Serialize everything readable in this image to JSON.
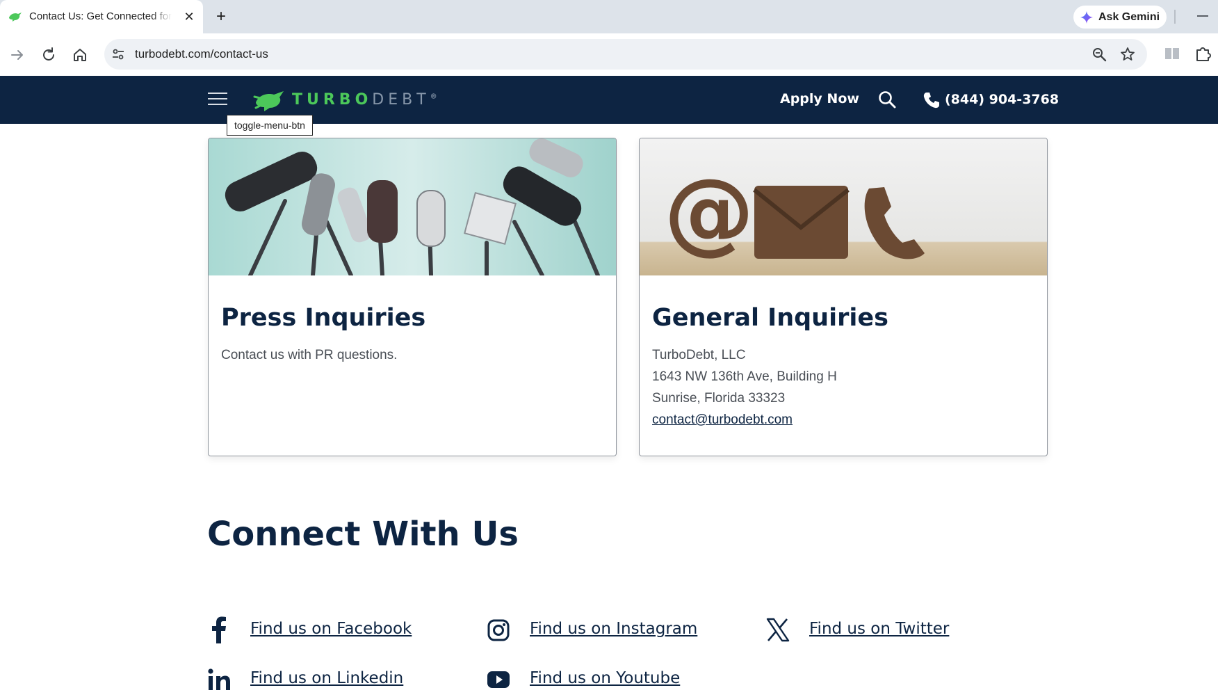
{
  "browser": {
    "tab_title": "Contact Us: Get Connected for Debt Help",
    "tab_close": "✕",
    "new_tab": "+",
    "gemini_label": "Ask Gemini",
    "url": "turbodebt.com/contact-us"
  },
  "header": {
    "logo_turbo": "TURBO",
    "logo_debt": "DEBT",
    "logo_mark": "®",
    "apply_now": "Apply Now",
    "phone": "(844) 904-3768",
    "tooltip": "toggle-menu-btn"
  },
  "cards": [
    {
      "image_icon": "microphones-image",
      "title": "Press Inquiries",
      "lines": [
        "Contact us with PR questions."
      ]
    },
    {
      "image_icon": "contact-symbols-image",
      "title": "General Inquiries",
      "lines": [
        "TurboDebt, LLC",
        "1643 NW 136th Ave, Building H",
        "Sunrise, Florida 33323"
      ],
      "email": "contact@turbodebt.com"
    }
  ],
  "connect": {
    "title": "Connect With Us",
    "links": [
      {
        "icon": "facebook-icon",
        "label": "Find us on Facebook"
      },
      {
        "icon": "instagram-icon",
        "label": "Find us on Instagram"
      },
      {
        "icon": "x-twitter-icon",
        "label": "Find us on Twitter"
      },
      {
        "icon": "linkedin-icon",
        "label": "Find us on Linkedin"
      },
      {
        "icon": "youtube-icon",
        "label": "Find us on Youtube"
      }
    ]
  },
  "colors": {
    "brand_navy": "#0d2442",
    "brand_green": "#4cc85a",
    "tab_strip": "#dde3ea"
  }
}
